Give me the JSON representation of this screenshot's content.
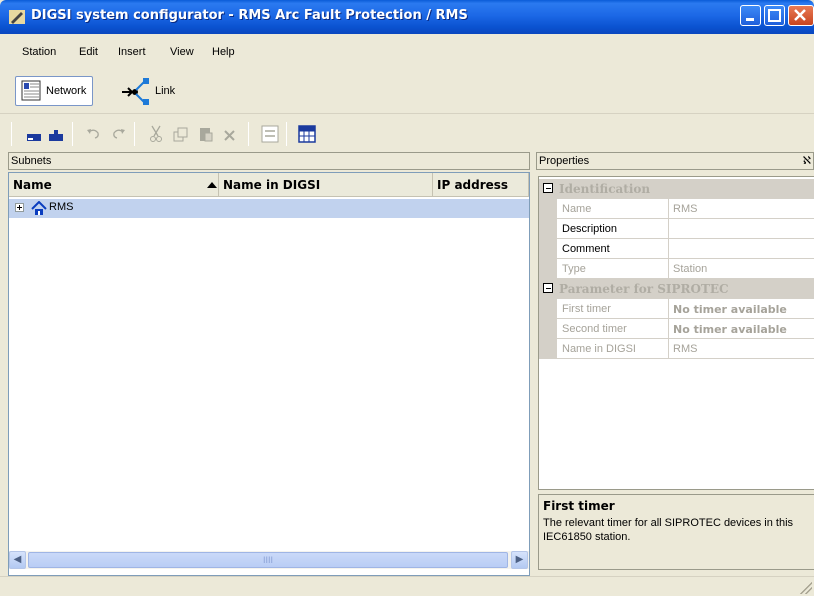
{
  "window": {
    "title": "DIGSI system configurator - RMS Arc Fault Protection / RMS"
  },
  "menu": [
    "Station",
    "Edit",
    "Insert",
    "View",
    "Help"
  ],
  "views": {
    "network": "Network",
    "link": "Link"
  },
  "left_panel": {
    "title": "Subnets",
    "columns": [
      "Name",
      "Name in DIGSI",
      "IP address"
    ],
    "rows": [
      {
        "name": "RMS",
        "name_in_digsi": "",
        "ip": ""
      }
    ],
    "scroll_grip": "IIII"
  },
  "properties": {
    "title": "Properties",
    "pin": "ℵ",
    "cat1": "Identification",
    "cat2": "Parameter for SIPROTEC",
    "rows": [
      {
        "name": "Name",
        "value": "RMS"
      },
      {
        "name": "Description",
        "value": ""
      },
      {
        "name": "Comment",
        "value": ""
      },
      {
        "name": "Type",
        "value": "Station"
      },
      {
        "name": "First timer",
        "value": "No timer available"
      },
      {
        "name": "Second timer",
        "value": "No timer available"
      },
      {
        "name": "Name in DIGSI",
        "value": "RMS"
      }
    ],
    "desc_title": "First timer",
    "desc_text": "The relevant timer for all SIPROTEC devices in this IEC61850 station."
  },
  "toolbar_icons": [
    "new-icon",
    "save-icon",
    "undo-icon",
    "redo-icon",
    "cut-icon",
    "copy-icon",
    "paste-icon",
    "delete-icon",
    "auto-ip-icon",
    "grid-icon"
  ],
  "colors": {
    "titlebar": "#0a52d0",
    "selection": "#c1d2ee"
  }
}
